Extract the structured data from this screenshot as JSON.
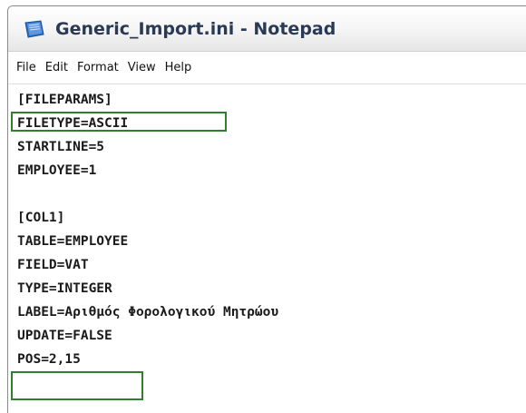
{
  "window": {
    "title": "Generic_Import.ini - Notepad",
    "icon": "notepad-icon"
  },
  "menu": [
    "File",
    "Edit",
    "Format",
    "View",
    "Help"
  ],
  "editor": {
    "lines": [
      "[FILEPARAMS]",
      "FILETYPE=ASCII",
      "STARTLINE=5",
      "EMPLOYEE=1",
      "",
      "[COL1]",
      "TABLE=EMPLOYEE",
      "FIELD=VAT",
      "TYPE=INTEGER",
      "LABEL=Αριθμός Φορολογικού Μητρώου",
      "UPDATE=FALSE",
      "POS=2,15"
    ],
    "highlighted_lines": [
      "FILETYPE=ASCII",
      "POS=2,15"
    ],
    "highlight_color": "#2f7f2f"
  }
}
